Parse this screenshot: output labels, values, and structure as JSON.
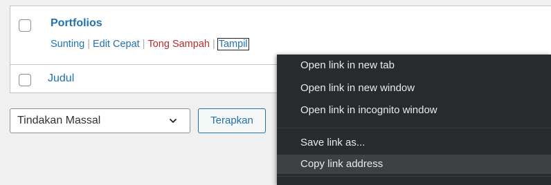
{
  "rows": [
    {
      "title": "Portfolios",
      "actions": {
        "edit": "Sunting",
        "quick_edit": "Edit Cepat",
        "trash": "Tong Sampah",
        "view": "Tampil"
      }
    },
    {
      "title": "Judul"
    }
  ],
  "bulk": {
    "selected_option": "Tindakan Massal",
    "apply_label": "Terapkan"
  },
  "context_menu": {
    "items": [
      "Open link in new tab",
      "Open link in new window",
      "Open link in incognito window",
      "Save link as...",
      "Copy link address"
    ],
    "highlighted": "Copy link address"
  },
  "colors": {
    "link": "#2271b1",
    "trash": "#b32d2e",
    "menu_bg": "#292a2d",
    "menu_highlight": "#3f4042"
  }
}
